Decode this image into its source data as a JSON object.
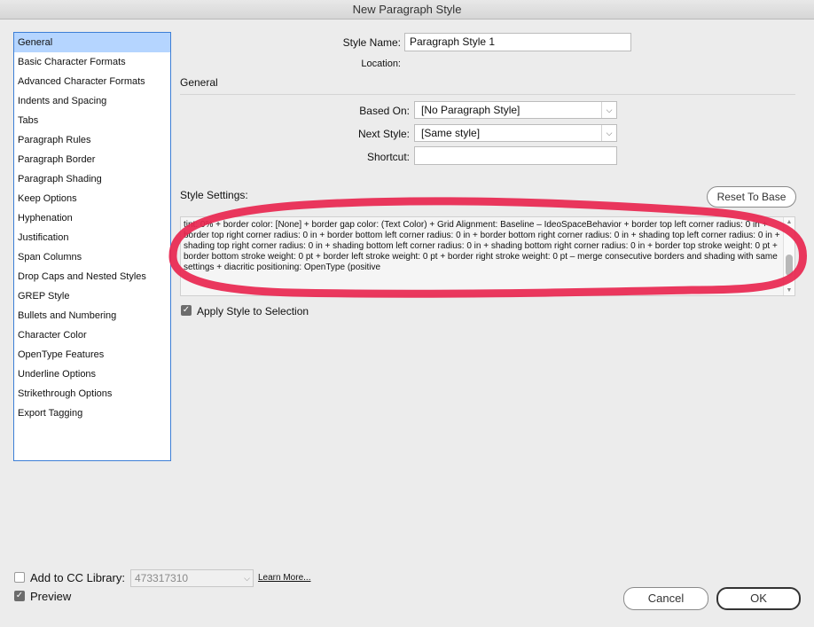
{
  "window": {
    "title": "New Paragraph Style"
  },
  "sidebar": {
    "items": [
      {
        "label": "General",
        "selected": true
      },
      {
        "label": "Basic Character Formats"
      },
      {
        "label": "Advanced Character Formats"
      },
      {
        "label": "Indents and Spacing"
      },
      {
        "label": "Tabs"
      },
      {
        "label": "Paragraph Rules"
      },
      {
        "label": "Paragraph Border"
      },
      {
        "label": "Paragraph Shading"
      },
      {
        "label": "Keep Options"
      },
      {
        "label": "Hyphenation"
      },
      {
        "label": "Justification"
      },
      {
        "label": "Span Columns"
      },
      {
        "label": "Drop Caps and Nested Styles"
      },
      {
        "label": "GREP Style"
      },
      {
        "label": "Bullets and Numbering"
      },
      {
        "label": "Character Color"
      },
      {
        "label": "OpenType Features"
      },
      {
        "label": "Underline Options"
      },
      {
        "label": "Strikethrough Options"
      },
      {
        "label": "Export Tagging"
      }
    ]
  },
  "header": {
    "style_name_label": "Style Name:",
    "style_name_value": "Paragraph Style 1",
    "location_label": "Location:"
  },
  "general": {
    "section_title": "General",
    "based_on_label": "Based On:",
    "based_on_value": "[No Paragraph Style]",
    "next_style_label": "Next Style:",
    "next_style_value": "[Same style]",
    "shortcut_label": "Shortcut:",
    "shortcut_value": ""
  },
  "settings": {
    "label": "Style Settings:",
    "reset_button": "Reset To Base",
    "text": "tint: 0% + border color: [None] + border gap color: (Text Color) + Grid Alignment:  Baseline – IdeoSpaceBehavior + border top left corner radius: 0 in + border top right corner radius: 0 in + border bottom left corner radius: 0 in + border bottom right corner radius: 0 in + shading top left corner radius: 0 in + shading top right corner radius: 0 in + shading bottom left corner radius: 0 in + shading bottom right corner radius: 0 in + border top stroke weight: 0 pt + border bottom stroke weight: 0 pt + border left stroke weight: 0 pt + border right stroke weight: 0 pt – merge consecutive borders and shading with same settings + diacritic positioning: OpenType (positive"
  },
  "apply_style": {
    "label": "Apply Style to Selection",
    "checked": true
  },
  "footer": {
    "cc_library_label": "Add to CC Library:",
    "cc_library_checked": false,
    "cc_library_value": "473317310",
    "learn_more": "Learn More...",
    "preview_label": "Preview",
    "preview_checked": true,
    "cancel_button": "Cancel",
    "ok_button": "OK"
  },
  "colors": {
    "annotation": "#e8264f",
    "selection": "#b5d5ff",
    "sidebar_border": "#3d7fd6"
  }
}
